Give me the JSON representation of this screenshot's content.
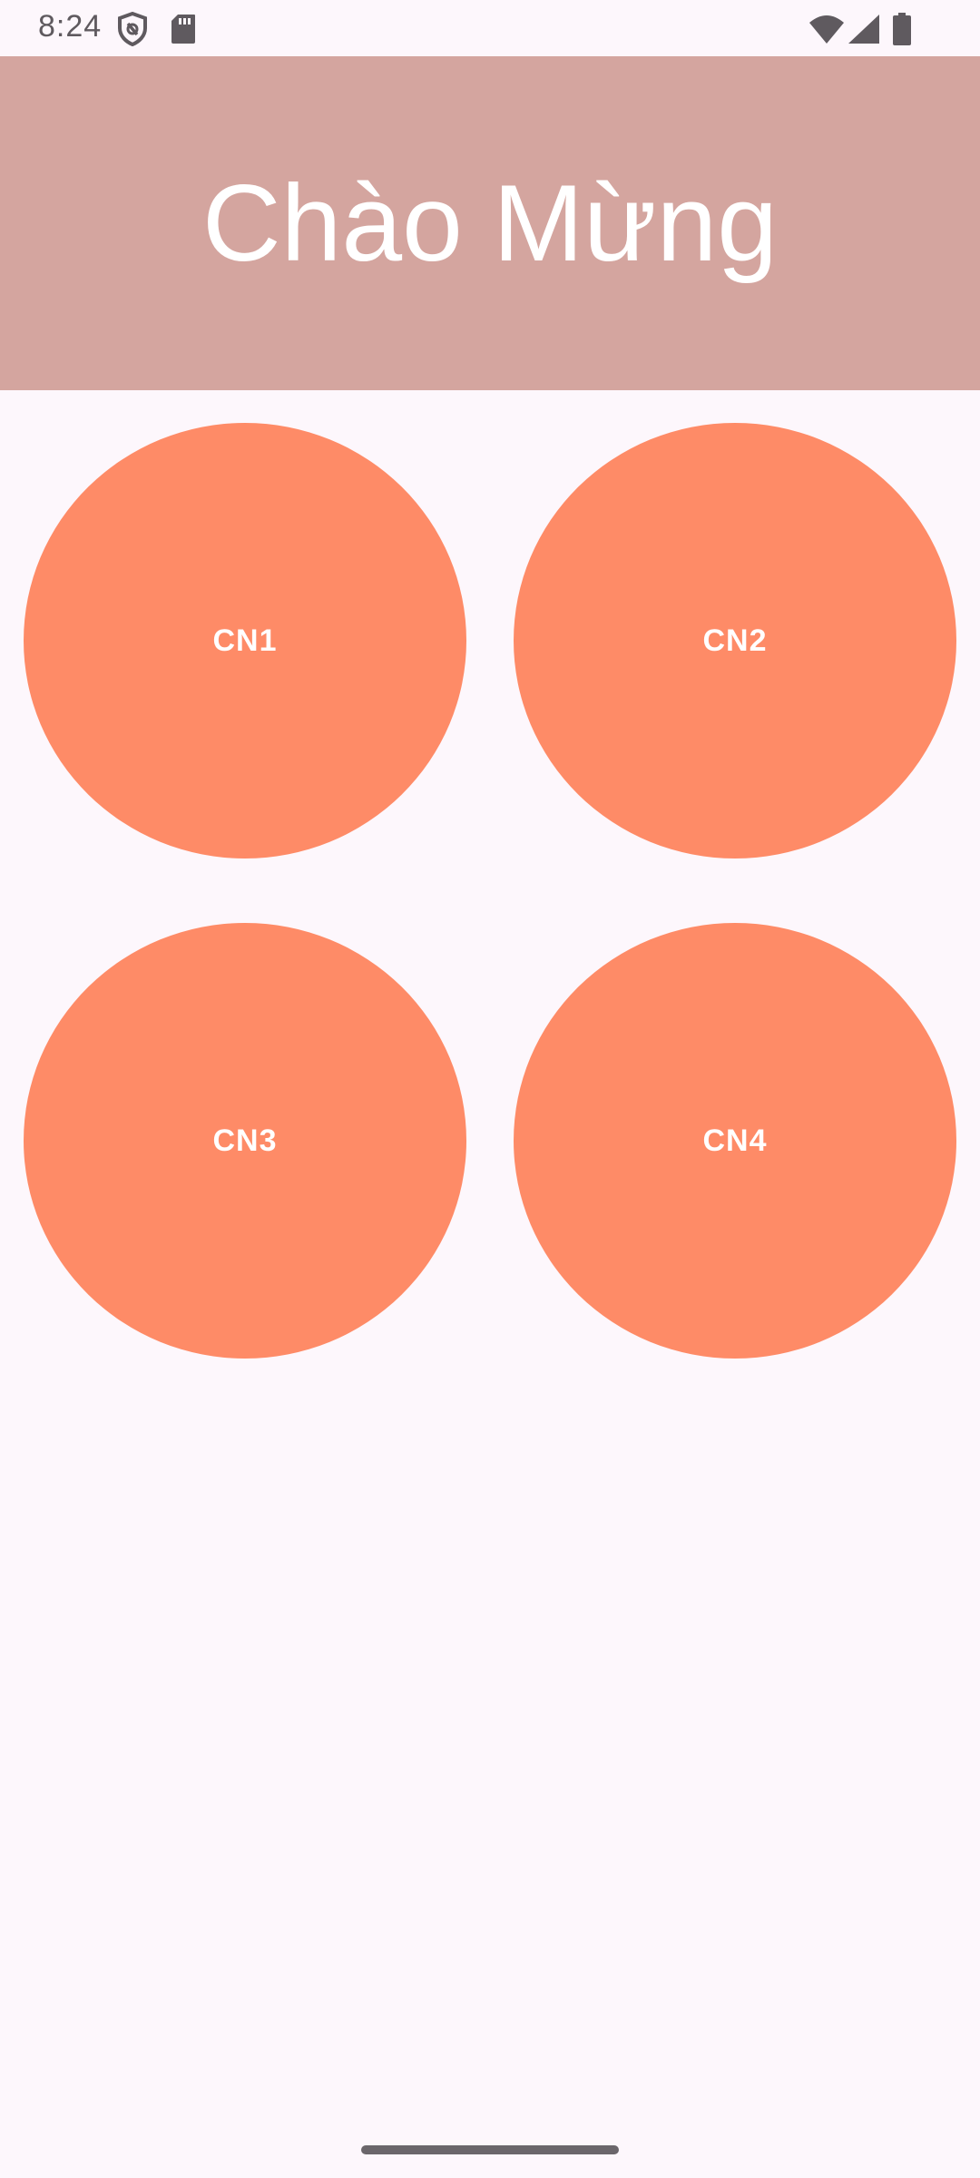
{
  "status_bar": {
    "time": "8:24",
    "icons": [
      "shield-icon",
      "sd-card-icon",
      "wifi-icon",
      "signal-icon",
      "battery-icon"
    ],
    "icon_color": "#5F5A5F"
  },
  "header": {
    "title": "Chào Mừng",
    "background": "#D4A59F",
    "text_color": "#FFFFFF"
  },
  "buttons": [
    {
      "label": "CN1"
    },
    {
      "label": "CN2"
    },
    {
      "label": "CN3"
    },
    {
      "label": "CN4"
    }
  ],
  "colors": {
    "button": "#FE8B67",
    "page_background": "#FDF7FC"
  }
}
